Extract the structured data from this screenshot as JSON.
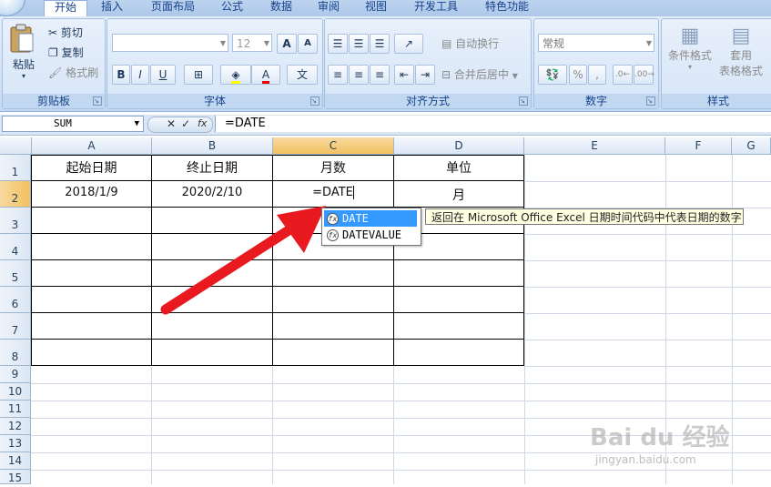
{
  "tabs": [
    "开始",
    "插入",
    "页面布局",
    "公式",
    "数据",
    "审阅",
    "视图",
    "开发工具",
    "特色功能"
  ],
  "clipboard": {
    "paste": "粘贴",
    "cut": "剪切",
    "copy": "复制",
    "format_painter": "格式刷",
    "label": "剪贴板"
  },
  "font": {
    "name": "",
    "size": "12",
    "bold": "B",
    "italic": "I",
    "underline": "U",
    "grow": "A",
    "shrink": "A",
    "label": "字体"
  },
  "alignment": {
    "wrap_text": "自动换行",
    "merge_center": "合并后居中",
    "label": "对齐方式"
  },
  "number": {
    "format": "常规",
    "percent": "%",
    "comma": ",",
    "label": "数字"
  },
  "styles": {
    "conditional": "条件格式",
    "table_line1": "套用",
    "table_line2": "表格格式",
    "label": "样式"
  },
  "formula_bar": {
    "name_box": "SUM",
    "cancel": "✕",
    "enter": "✓",
    "fx": "fx",
    "content": "=DATE"
  },
  "columns": [
    "A",
    "B",
    "C",
    "D",
    "E",
    "F",
    "G"
  ],
  "rows": [
    "1",
    "2",
    "3",
    "4",
    "5",
    "6",
    "7",
    "8",
    "9",
    "10",
    "11",
    "12",
    "13",
    "14",
    "15"
  ],
  "cells": {
    "A1": "起始日期",
    "B1": "终止日期",
    "C1": "月数",
    "D1": "单位",
    "A2": "2018/1/9",
    "B2": "2020/2/10",
    "C2": "=DATE",
    "D2": "月"
  },
  "autocomplete": {
    "items": [
      "DATE",
      "DATEVALUE"
    ],
    "icon": "fx",
    "tooltip": "返回在 Microsoft Office Excel 日期时间代码中代表日期的数字"
  },
  "watermark": {
    "logo": "Bai du 经验",
    "url": "jingyan.baidu.com"
  },
  "colors": {
    "arrow": "#e8191f",
    "selected_header": "#f1c15f",
    "ribbon": "#d1e1f5",
    "highlight": "#3399ff"
  }
}
